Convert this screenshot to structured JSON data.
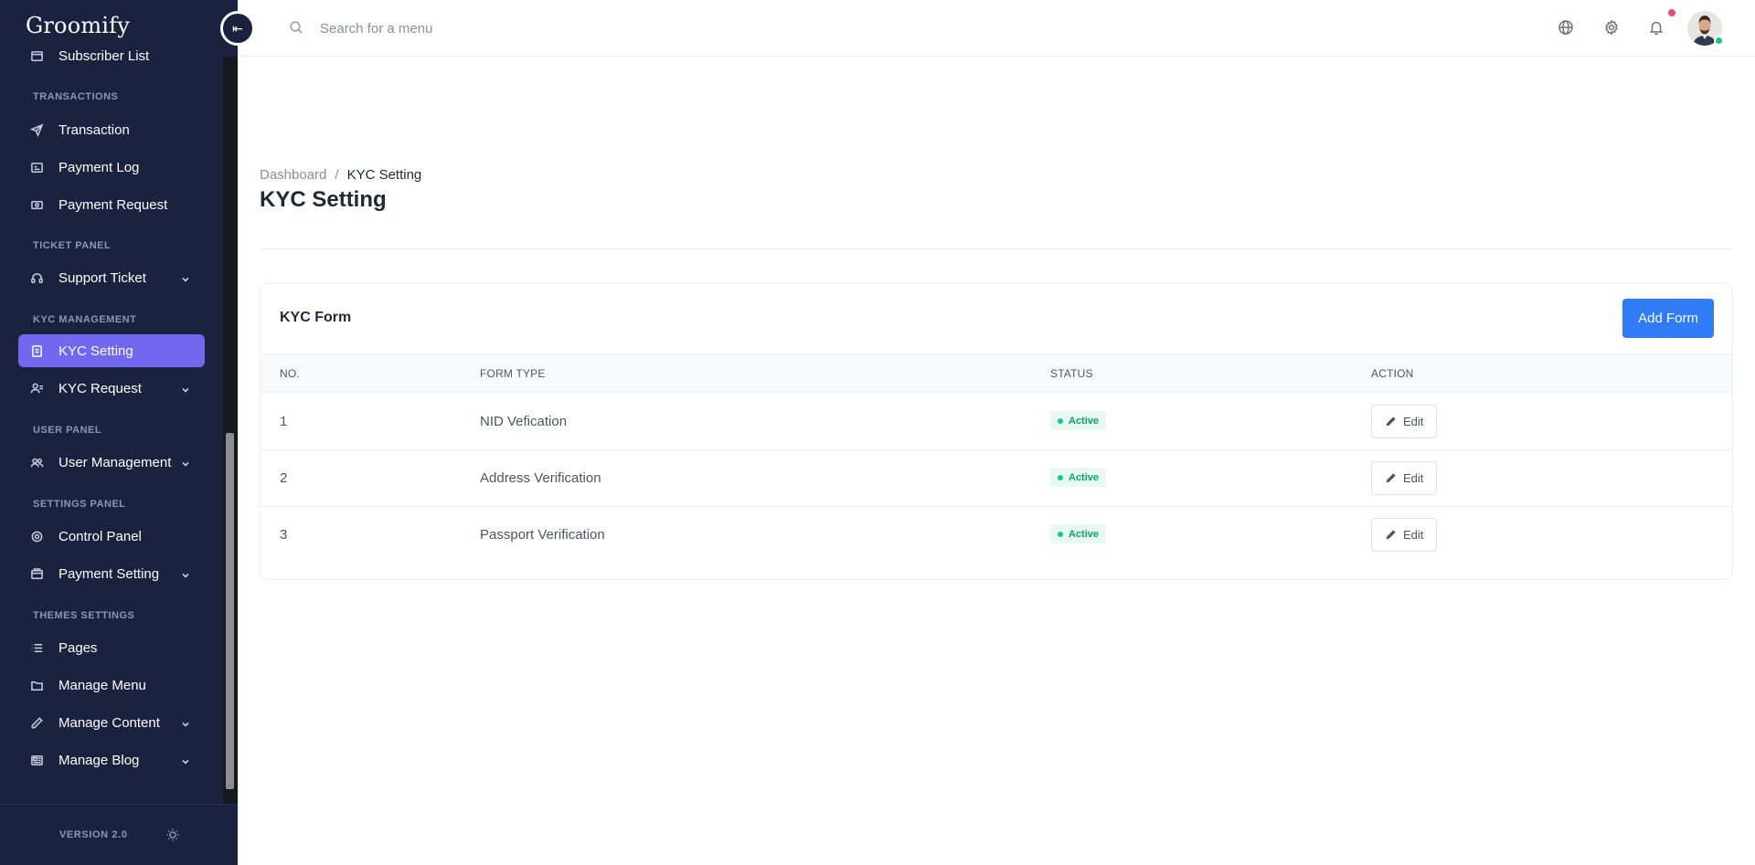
{
  "brand": "Groomify",
  "search": {
    "placeholder": "Search for a menu"
  },
  "sidebar": {
    "partial_item": "Subscriber List",
    "sections": [
      {
        "label": "TRANSACTIONS"
      },
      {
        "label": "TICKET PANEL"
      },
      {
        "label": "KYC MANAGEMENT"
      },
      {
        "label": "USER PANEL"
      },
      {
        "label": "SETTINGS PANEL"
      },
      {
        "label": "THEMES SETTINGS"
      }
    ],
    "items": [
      {
        "label": "Transaction",
        "icon": "send-icon",
        "has_submenu": false
      },
      {
        "label": "Payment Log",
        "icon": "log-icon",
        "has_submenu": false
      },
      {
        "label": "Payment Request",
        "icon": "money-icon",
        "has_submenu": false
      },
      {
        "label": "Support Ticket",
        "icon": "headset-icon",
        "has_submenu": true
      },
      {
        "label": "KYC Setting",
        "icon": "kyc-icon",
        "has_submenu": false,
        "active": true
      },
      {
        "label": "KYC Request",
        "icon": "user-list-icon",
        "has_submenu": true
      },
      {
        "label": "User Management",
        "icon": "users-icon",
        "has_submenu": true
      },
      {
        "label": "Control Panel",
        "icon": "gear-icon",
        "has_submenu": false
      },
      {
        "label": "Payment Setting",
        "icon": "wallet-icon",
        "has_submenu": true
      },
      {
        "label": "Pages",
        "icon": "list-icon",
        "has_submenu": false
      },
      {
        "label": "Manage Menu",
        "icon": "folder-icon",
        "has_submenu": false
      },
      {
        "label": "Manage Content",
        "icon": "pencil-icon",
        "has_submenu": true
      },
      {
        "label": "Manage Blog",
        "icon": "newspaper-icon",
        "has_submenu": true
      }
    ],
    "version": "VERSION 2.0"
  },
  "colors": {
    "sidebar_bg": "#1a2240",
    "active_item": "#7367f0",
    "primary_button": "#2f7cf6",
    "status_active": "#10c98f",
    "notification": "#ec4a73"
  },
  "breadcrumb": {
    "home": "Dashboard",
    "separator": "/",
    "current": "KYC Setting"
  },
  "page": {
    "title": "KYC Setting"
  },
  "card": {
    "title": "KYC Form",
    "add_button": "Add Form",
    "columns": [
      "NO.",
      "FORM TYPE",
      "STATUS",
      "ACTION"
    ],
    "rows": [
      {
        "no": "1",
        "form_type": "NID Vefication",
        "status": "Active",
        "action": "Edit"
      },
      {
        "no": "2",
        "form_type": "Address Verification",
        "status": "Active",
        "action": "Edit"
      },
      {
        "no": "3",
        "form_type": "Passport Verification",
        "status": "Active",
        "action": "Edit"
      }
    ]
  }
}
